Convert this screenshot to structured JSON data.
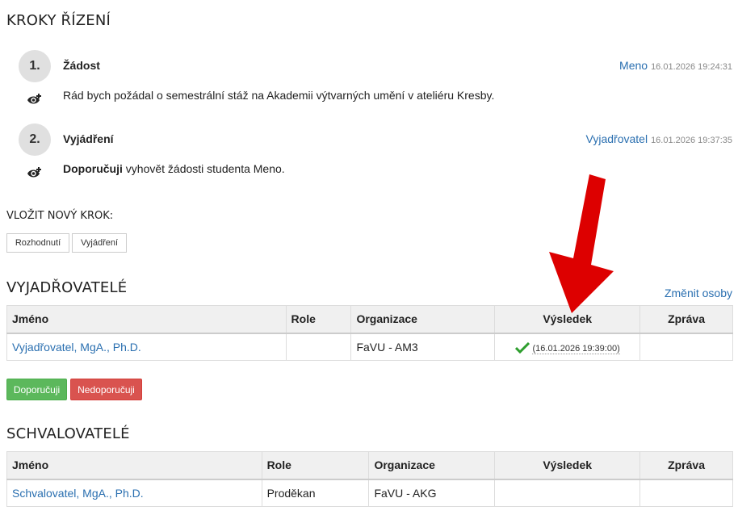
{
  "steps_section": {
    "title": "KROKY ŘÍZENÍ"
  },
  "steps": [
    {
      "number": "1.",
      "title": "Žádost",
      "author": "Meno",
      "timestamp": "16.01.2026 19:24:31",
      "text": "Rád bych požádal o semestrální stáž na Akademii výtvarných umění v ateliéru Kresby."
    },
    {
      "number": "2.",
      "title": "Vyjádření",
      "author": "Vyjadřovatel",
      "timestamp": "16.01.2026 19:37:35",
      "text_bold": "Doporučuji",
      "text_rest": " vyhovět žádosti studenta Meno."
    }
  ],
  "new_step": {
    "label": "VLOŽIT NOVÝ KROK:",
    "buttons": [
      "Rozhodnutí",
      "Vyjádření"
    ]
  },
  "reviewers": {
    "title": "VYJADŘOVATELÉ",
    "change_link": "Změnit osoby",
    "columns": [
      "Jméno",
      "Role",
      "Organizace",
      "Výsledek",
      "Zpráva"
    ],
    "rows": [
      {
        "name": "Vyjadřovatel, MgA., Ph.D.",
        "role": "",
        "organization": "FaVU - AM3",
        "result": "(16.01.2026 19:39:00)",
        "message": ""
      }
    ],
    "recommend_button": "Doporučuji",
    "not_recommend_button": "Nedoporučuji"
  },
  "approvers": {
    "title": "SCHVALOVATELÉ",
    "columns": [
      "Jméno",
      "Role",
      "Organizace",
      "Výsledek",
      "Zpráva"
    ],
    "rows": [
      {
        "name": "Schvalovatel, MgA., Ph.D.",
        "role": "Proděkan",
        "organization": "FaVU - AKG",
        "result": "",
        "message": ""
      }
    ]
  },
  "colors": {
    "link": "#2a6fb0",
    "success": "#5cb85c",
    "danger": "#d9534f",
    "annotation_arrow": "#dd0000"
  },
  "icons": [
    "eye-plus-icon",
    "checkmark-icon",
    "red-arrow-annotation"
  ]
}
